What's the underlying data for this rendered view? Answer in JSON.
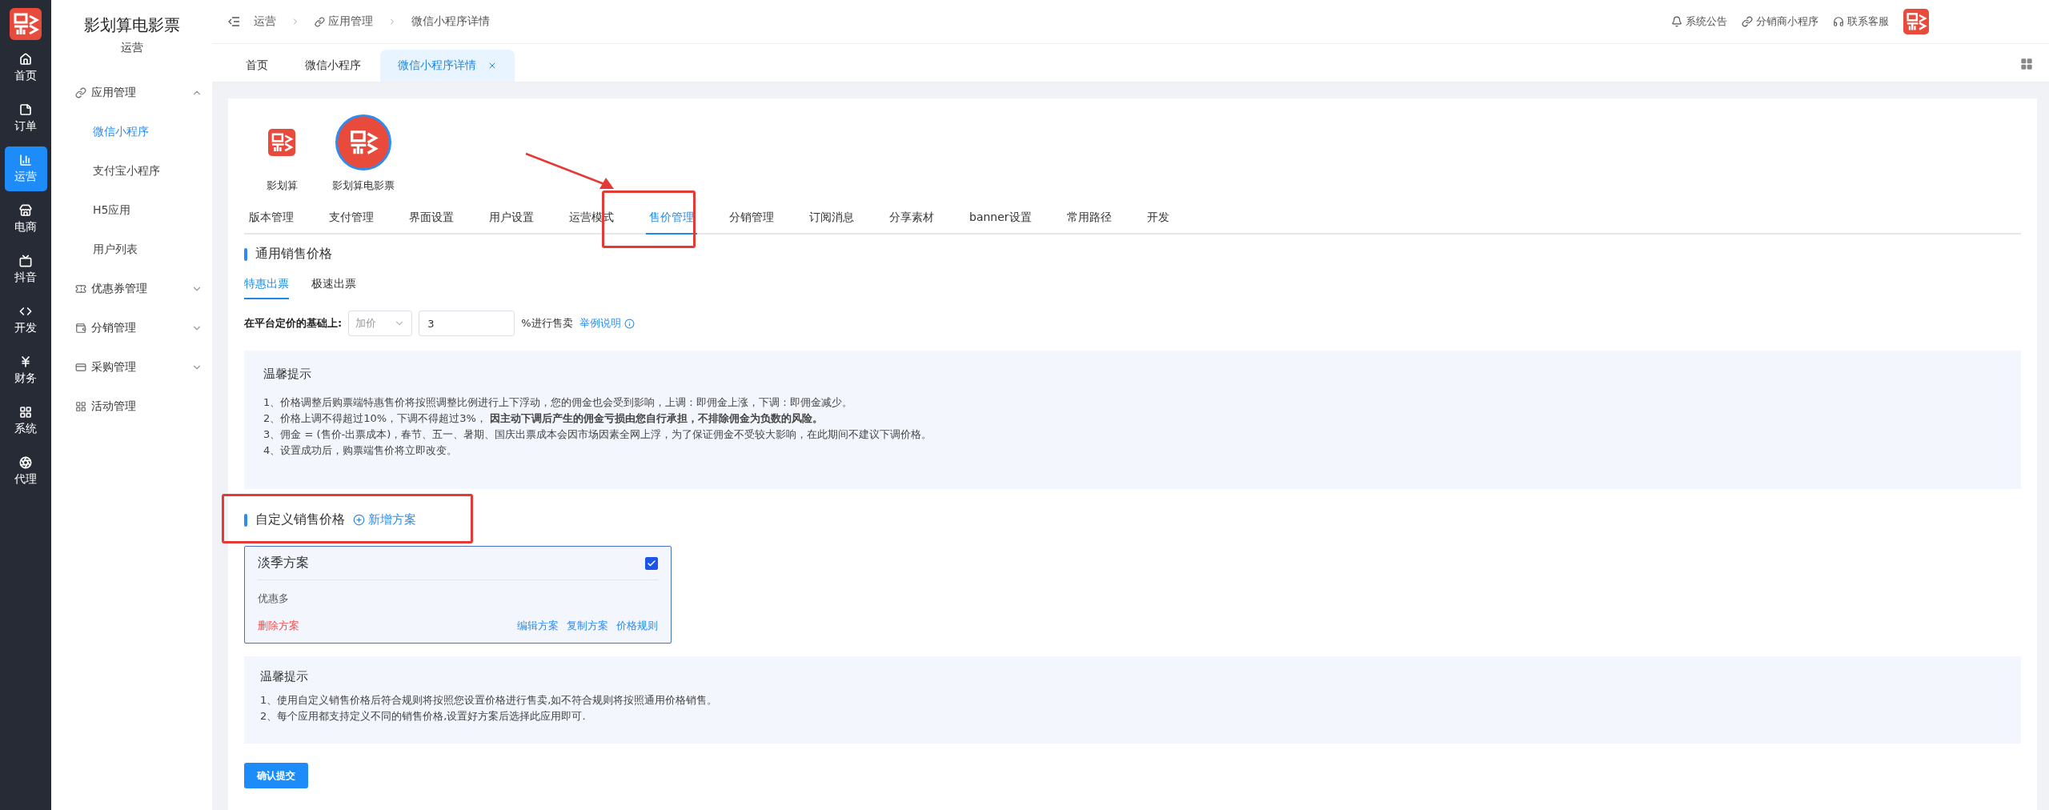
{
  "rail": {
    "items": [
      {
        "label": "首页",
        "selected": false
      },
      {
        "label": "订单",
        "selected": false
      },
      {
        "label": "运营",
        "selected": true
      },
      {
        "label": "电商",
        "selected": false
      },
      {
        "label": "抖音",
        "selected": false
      },
      {
        "label": "开发",
        "selected": false
      },
      {
        "label": "财务",
        "selected": false
      },
      {
        "label": "系统",
        "selected": false
      },
      {
        "label": "代理",
        "selected": false
      }
    ]
  },
  "sidebar": {
    "title": "影划算电影票",
    "subtitle": "运营",
    "items": [
      {
        "label": "应用管理",
        "expanded": true,
        "children": [
          {
            "label": "微信小程序",
            "selected": true
          },
          {
            "label": "支付宝小程序",
            "selected": false
          },
          {
            "label": "H5应用",
            "selected": false
          },
          {
            "label": "用户列表",
            "selected": false
          }
        ]
      },
      {
        "label": "优惠券管理",
        "expanded": false
      },
      {
        "label": "分销管理",
        "expanded": false
      },
      {
        "label": "采购管理",
        "expanded": false
      },
      {
        "label": "活动管理"
      }
    ]
  },
  "breadcrumb": [
    "运营",
    "应用管理",
    "微信小程序详情"
  ],
  "header_links": [
    "系统公告",
    "分销商小程序",
    "联系客服"
  ],
  "page_tabs": [
    {
      "label": "首页",
      "selected": false
    },
    {
      "label": "微信小程序",
      "selected": false
    },
    {
      "label": "微信小程序详情",
      "selected": true
    }
  ],
  "apps": [
    {
      "label": "影划算",
      "selected": false
    },
    {
      "label": "影划算电影票",
      "selected": true
    }
  ],
  "detail_tabs": [
    {
      "label": "版本管理",
      "selected": false
    },
    {
      "label": "支付管理",
      "selected": false
    },
    {
      "label": "界面设置",
      "selected": false
    },
    {
      "label": "用户设置",
      "selected": false
    },
    {
      "label": "运营模式",
      "selected": false
    },
    {
      "label": "售价管理",
      "selected": true
    },
    {
      "label": "分销管理",
      "selected": false
    },
    {
      "label": "订阅消息",
      "selected": false
    },
    {
      "label": "分享素材",
      "selected": false
    },
    {
      "label": "banner设置",
      "selected": false
    },
    {
      "label": "常用路径",
      "selected": false
    },
    {
      "label": "开发",
      "selected": false
    }
  ],
  "general_price": {
    "title": "通用销售价格",
    "subtabs": [
      {
        "label": "特惠出票",
        "selected": true
      },
      {
        "label": "极速出票",
        "selected": false
      }
    ],
    "rule_label": "在平台定价的基础上:",
    "mode_select": "加价",
    "percent_value": "3",
    "suffix": "%进行售卖",
    "example_link": "举例说明",
    "tips": {
      "title": "温馨提示",
      "lines": [
        "1、价格调整后购票端特惠售价将按照调整比例进行上下浮动，您的佣金也会受到影响，上调：即佣金上涨，下调：即佣金减少。",
        "2、价格上调不得超过10%，下调不得超过3%， **因主动下调后产生的佣金亏损由您自行承担，不排除佣金为负数的风险。**",
        "3、佣金 = (售价-出票成本)，春节、五一、暑期、国庆出票成本会因市场因素全网上浮，为了保证佣金不受较大影响，在此期间不建议下调价格。",
        "4、设置成功后，购票端售价将立即改变。"
      ]
    }
  },
  "custom_price": {
    "title": "自定义销售价格",
    "add_link": "新增方案",
    "plans": [
      {
        "name": "淡季方案",
        "checked": true,
        "description": "优惠多",
        "delete": "删除方案",
        "actions": [
          "编辑方案",
          "复制方案",
          "价格规则"
        ]
      }
    ],
    "tips": {
      "title": "温馨提示",
      "lines": [
        "1、使用自定义销售价格后符合规则将按照您设置价格进行售卖,如不符合规则将按照通用价格销售。",
        "2、每个应用都支持定义不同的销售价格,设置好方案后选择此应用即可."
      ]
    }
  },
  "submit": "确认提交"
}
